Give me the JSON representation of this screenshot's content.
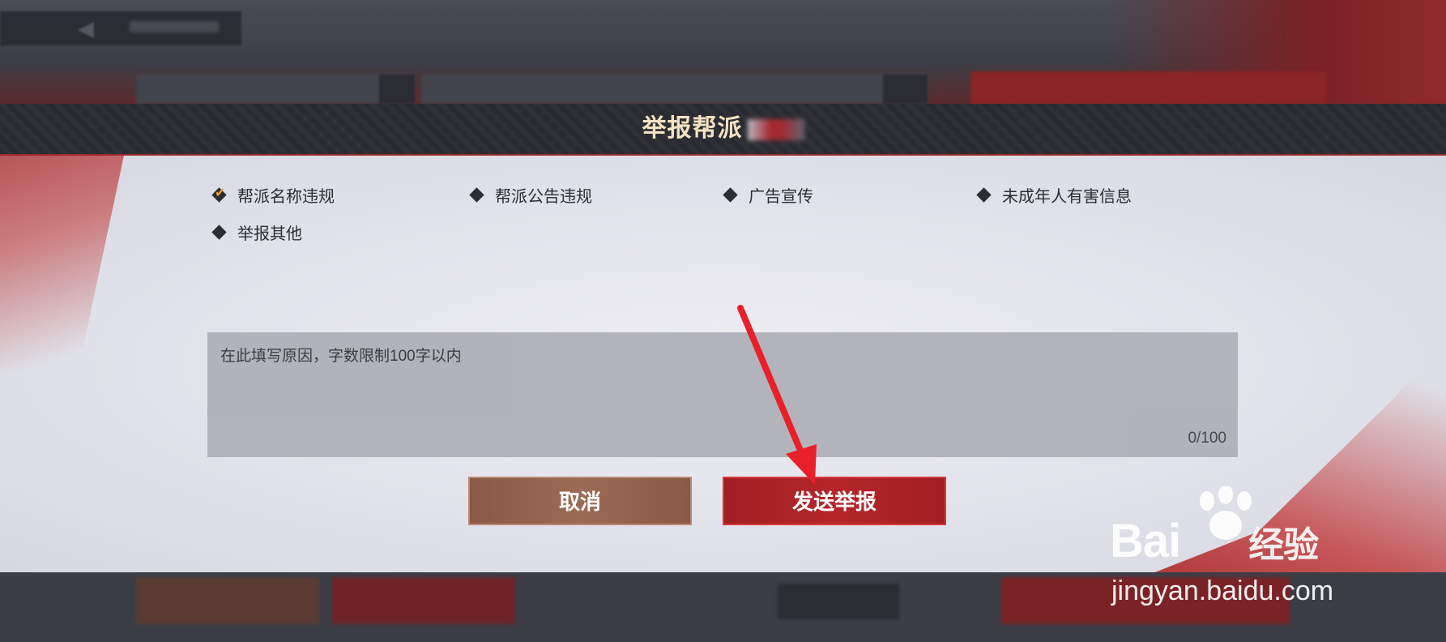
{
  "dialog": {
    "title": "举报帮派"
  },
  "options": [
    {
      "label": "帮派名称违规",
      "checked": true
    },
    {
      "label": "帮派公告违规",
      "checked": false
    },
    {
      "label": "广告宣传",
      "checked": false
    },
    {
      "label": "未成年人有害信息",
      "checked": false
    },
    {
      "label": "举报其他",
      "checked": false
    }
  ],
  "reason_input": {
    "placeholder": "在此填写原因，字数限制100字以内",
    "counter": "0/100"
  },
  "buttons": {
    "cancel": "取消",
    "send": "发送举报"
  },
  "watermark": {
    "logo_text": "Bai",
    "logo_suffix": "经验",
    "url": "jingyan.baidu.com"
  },
  "colors": {
    "accent_red": "#b5272b",
    "check_orange": "#e8a623",
    "title_gold": "#f2e2c4"
  }
}
